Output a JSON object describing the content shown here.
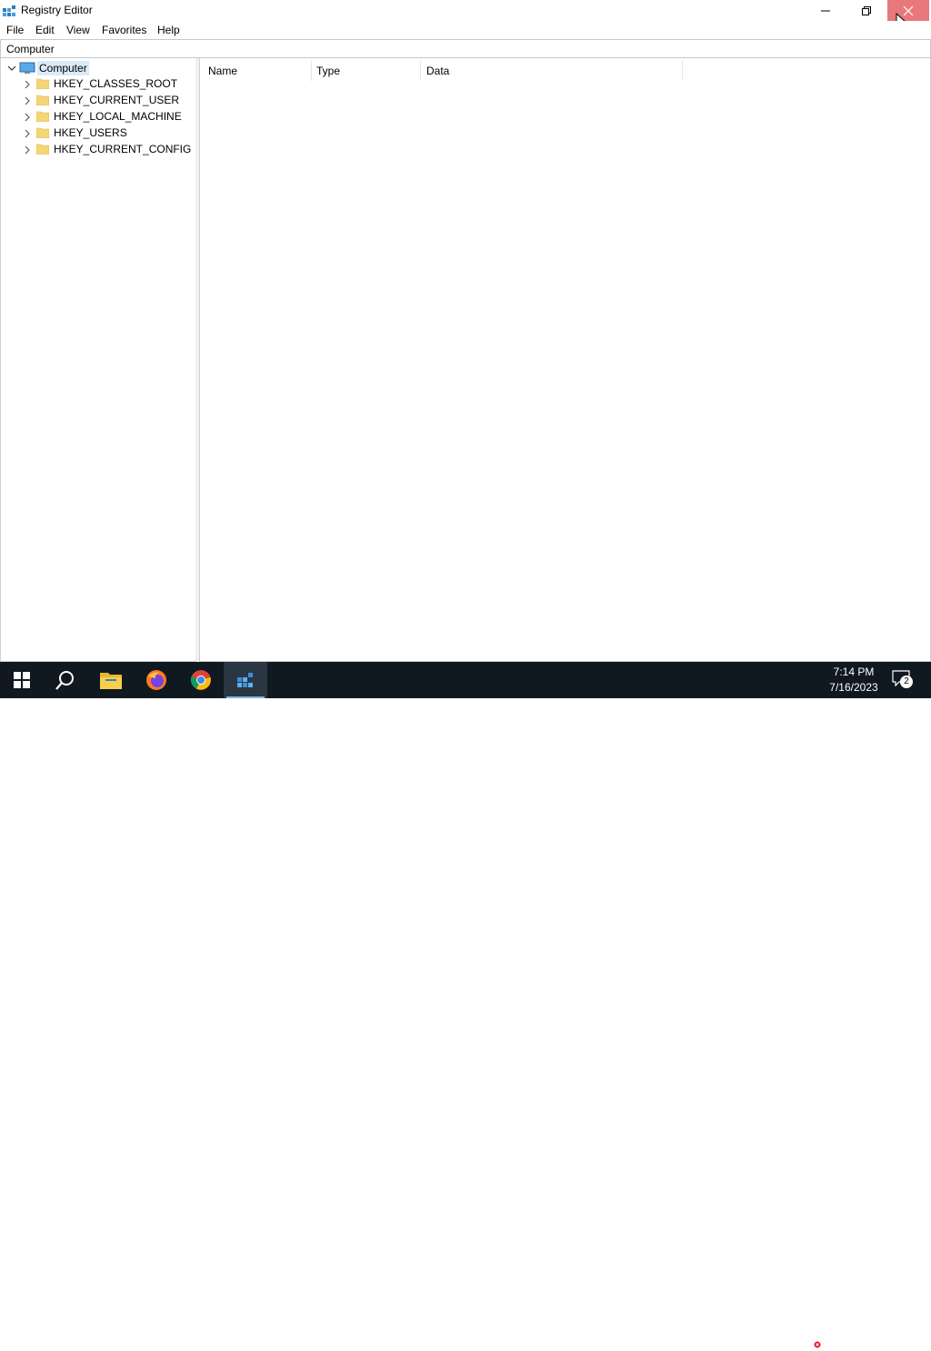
{
  "window": {
    "title": "Registry Editor"
  },
  "menu": [
    "File",
    "Edit",
    "View",
    "Favorites",
    "Help"
  ],
  "address": "Computer",
  "tree": {
    "root": "Computer",
    "children": [
      "HKEY_CLASSES_ROOT",
      "HKEY_CURRENT_USER",
      "HKEY_LOCAL_MACHINE",
      "HKEY_USERS",
      "HKEY_CURRENT_CONFIG"
    ]
  },
  "list": {
    "columns": [
      "Name",
      "Type",
      "Data"
    ]
  },
  "taskbar": {
    "apps": [
      "start-icon",
      "search-icon",
      "file-explorer-icon",
      "firefox-icon",
      "chrome-icon",
      "registry-editor-icon"
    ],
    "time": "7:14 PM",
    "date": "7/16/2023",
    "notifications": "2"
  },
  "colors": {
    "close_hover": "#e8787c",
    "taskbar": "#101820",
    "selection": "#d9ebf9",
    "folder": "#f5d575"
  }
}
